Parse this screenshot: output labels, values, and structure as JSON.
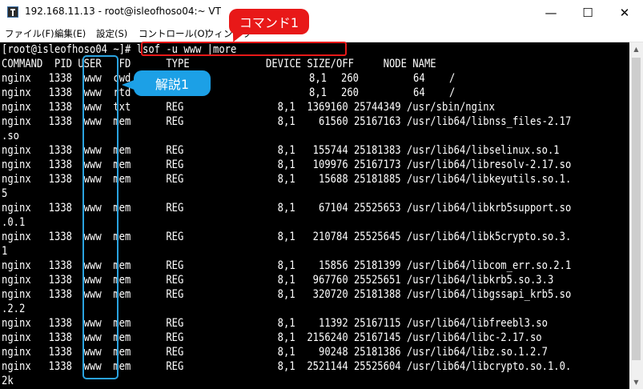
{
  "window": {
    "title": "192.168.11.13 - root@isleofhoso04:~ VT",
    "minimize_icon": "minimize-icon",
    "maximize_icon": "maximize-icon",
    "close_icon": "close-icon",
    "minimize_glyph": "—",
    "maximize_glyph": "☐",
    "close_glyph": "✕"
  },
  "menu": {
    "items": [
      "ファイル(F)",
      "編集(E)",
      "設定(S)",
      "コントロール(O)",
      "ウィンドウ"
    ]
  },
  "terminal": {
    "lines": [
      "[root@isleofhoso04 ~]# lsof -u www |more",
      "COMMAND  PID USER   FD      TYPE             DEVICE SIZE/OFF     NODE NAME",
      "nginx   1338  www  cwd",
      "nginx   1338  www  rtd",
      "nginx   1338  www  txt      REG                8,1  1369160 25744349 /usr/sbin/nginx",
      "nginx   1338  www  mem      REG                8,1    61560 25167163 /usr/lib64/libnss_files-2.17",
      ".so",
      "nginx   1338  www  mem      REG                8,1   155744 25181383 /usr/lib64/libselinux.so.1",
      "nginx   1338  www  mem      REG                8,1   109976 25167173 /usr/lib64/libresolv-2.17.so",
      "nginx   1338  www  mem      REG                8,1    15688 25181885 /usr/lib64/libkeyutils.so.1.",
      "5",
      "nginx   1338  www  mem      REG                8,1    67104 25525653 /usr/lib64/libkrb5support.so",
      ".0.1",
      "nginx   1338  www  mem      REG                8,1   210784 25525645 /usr/lib64/libk5crypto.so.3.",
      "1",
      "nginx   1338  www  mem      REG                8,1    15856 25181399 /usr/lib64/libcom_err.so.2.1",
      "nginx   1338  www  mem      REG                8,1   967760 25525651 /usr/lib64/libkrb5.so.3.3",
      "nginx   1338  www  mem      REG                8,1   320720 25181388 /usr/lib64/libgssapi_krb5.so",
      ".2.2",
      "nginx   1338  www  mem      REG                8,1    11392 25167115 /usr/lib64/libfreebl3.so",
      "nginx   1338  www  mem      REG                8,1  2156240 25167145 /usr/lib64/libc-2.17.so",
      "nginx   1338  www  mem      REG                8,1    90248 25181386 /usr/lib64/libz.so.1.2.7",
      "nginx   1338  www  mem      REG                8,1  2521144 25525604 /usr/lib64/libcrypto.so.1.0.",
      "2k"
    ],
    "row_260a": {
      "size": "260",
      "node": "64",
      "name": "/"
    },
    "row_260b": {
      "size": "260",
      "node": "64",
      "name": "/"
    }
  },
  "annotations": {
    "command_label": "コマンド1",
    "explain_label": "解説1",
    "command_color": "#e81818",
    "explain_color": "#1ca0e6"
  },
  "scrollbar": {
    "up_icon": "scroll-up-arrow-icon",
    "down_icon": "scroll-down-arrow-icon",
    "up_glyph": "▲",
    "down_glyph": "▼"
  }
}
